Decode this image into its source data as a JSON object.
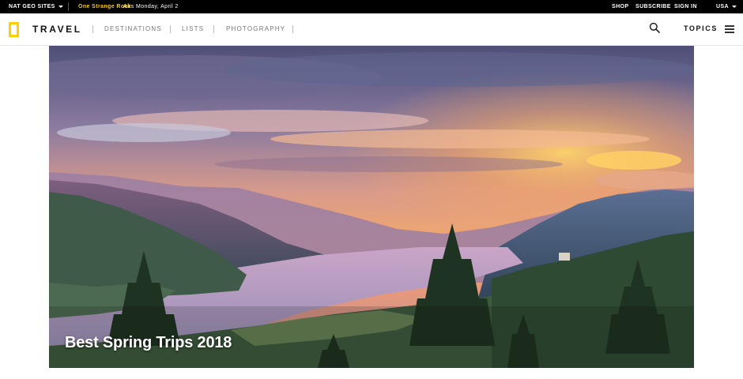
{
  "topbar": {
    "natgeo_sites": "NAT GEO SITES",
    "promo_title": "One Strange Rock",
    "promo_airs": "Airs Monday, April 2",
    "shop": "SHOP",
    "subscribe": "SUBSCRIBE",
    "sign_in": "SIGN IN",
    "region": "USA"
  },
  "nav": {
    "brand": "TRAVEL",
    "links": [
      "DESTINATIONS",
      "LISTS",
      "PHOTOGRAPHY"
    ],
    "topics": "TOPICS"
  },
  "hero": {
    "title": "Best Spring Trips 2018"
  },
  "colors": {
    "logo_yellow": "#ffce00",
    "promo_yellow": "#ffcc00"
  },
  "icons": [
    "caret-down-icon",
    "nat-geo-logo",
    "search-icon",
    "menu-icon"
  ]
}
